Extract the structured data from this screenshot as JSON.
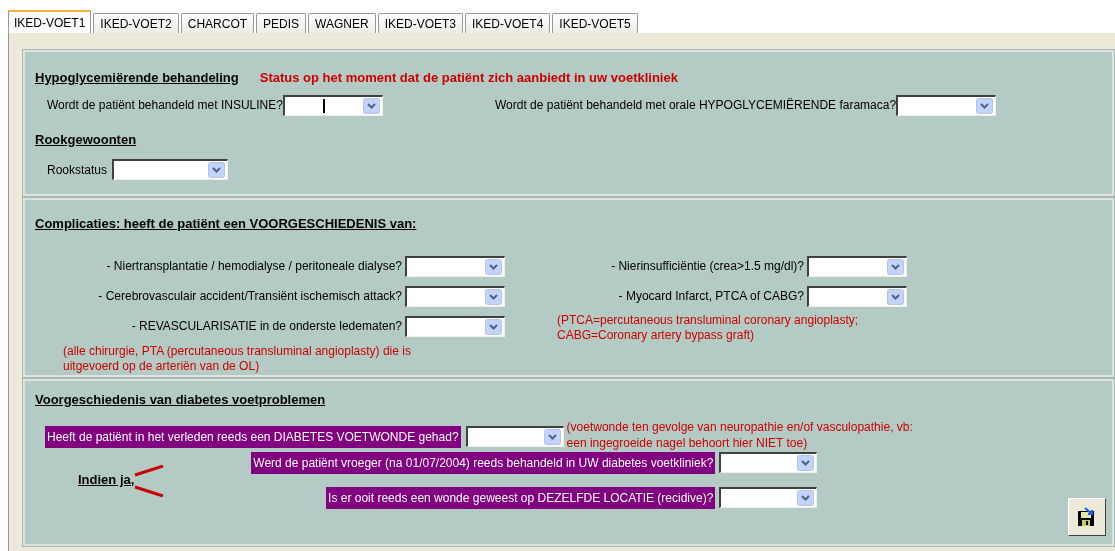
{
  "tabs": [
    {
      "label": "IKED-VOET1",
      "selected": true
    },
    {
      "label": "IKED-VOET2",
      "selected": false
    },
    {
      "label": "CHARCOT",
      "selected": false
    },
    {
      "label": "PEDIS",
      "selected": false
    },
    {
      "label": "WAGNER",
      "selected": false
    },
    {
      "label": "IKED-VOET3",
      "selected": false
    },
    {
      "label": "IKED-VOET4",
      "selected": false
    },
    {
      "label": "IKED-VOET5",
      "selected": false
    }
  ],
  "treatment": {
    "heading": "Hypoglycemiërende behandeling",
    "status_note": "Status op het moment dat de patiënt zich aanbiedt in uw voetkliniek",
    "questions": [
      {
        "label": "Wordt de patiënt behandeld met INSULINE?",
        "focused": true
      },
      {
        "label": "Wordt de patiënt behandeld met orale HYPOGLYCEMIËRENDE faramaca?",
        "focused": false
      }
    ]
  },
  "smoking": {
    "heading": "Rookgewoonten",
    "label": "Rookstatus"
  },
  "complications": {
    "heading": "Complicaties: heeft de patiënt een VOORGESCHIEDENIS van:",
    "left": [
      "- Niertransplantatie / hemodialyse / peritoneale dialyse?",
      "- Cerebrovasculair accident/Transiënt ischemisch attack?",
      "- REVASCULARISATIE in de onderste ledematen?"
    ],
    "left_note": [
      "(alle chirurgie, PTA (percutaneous transluminal angioplasty) die is",
      "uitgevoerd op de arteriën van de OL)"
    ],
    "right": [
      "- Nierinsufficiëntie (crea>1.5 mg/dl)?",
      "- Myocard Infarct, PTCA of CABG?"
    ],
    "right_note": [
      "(PTCA=percutaneous transluminal coronary angioplasty;",
      "CABG=Coronary artery bypass graft)"
    ]
  },
  "foot_history": {
    "heading": "Voorgeschiedenis van diabetes voetproblemen",
    "main_question": "Heeft de patiënt in het verleden reeds een DIABETES VOETWONDE gehad?",
    "main_note": [
      "(voetwonde ten gevolge van neuropathie en/of vasculopathie, vb:",
      "een ingegroeide nagel behoort hier NIET toe)"
    ],
    "followup_label": "Indien ja,",
    "followups": [
      "Werd de patiënt vroeger (na 01/07/2004) reeds behandeld in UW diabetes voetkliniek?",
      "Is er ooit reeds een wonde geweest op DEZELFDE LOCATIE (recidive)?"
    ]
  }
}
